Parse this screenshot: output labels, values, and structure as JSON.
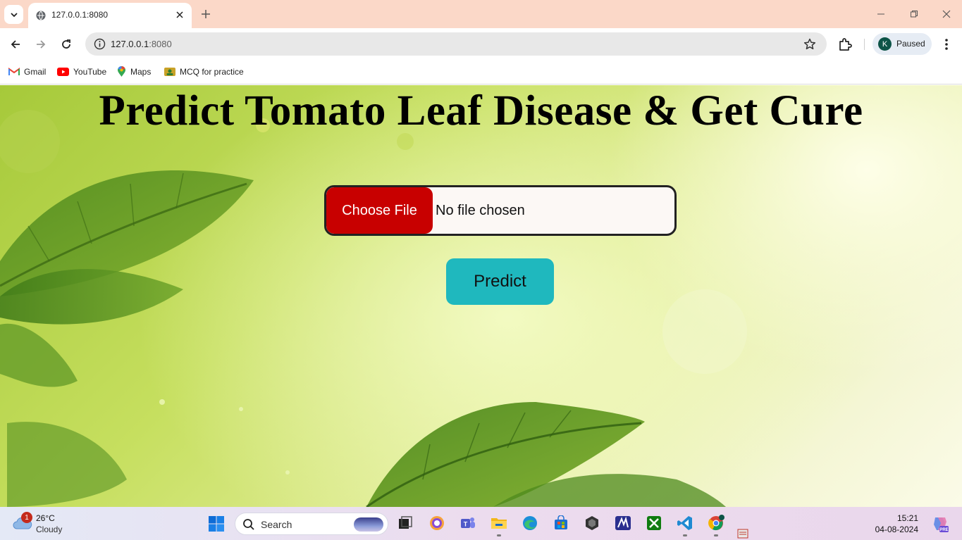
{
  "browser": {
    "tab_title": "127.0.0.1:8080",
    "url_host": "127.0.0.1",
    "url_port": ":8080",
    "profile_initial": "K",
    "profile_status": "Paused",
    "bookmarks": [
      {
        "label": "Gmail",
        "icon": "gmail-icon"
      },
      {
        "label": "YouTube",
        "icon": "youtube-icon"
      },
      {
        "label": "Maps",
        "icon": "maps-icon"
      },
      {
        "label": "MCQ for practice",
        "icon": "bookmark-folder-icon"
      }
    ]
  },
  "page": {
    "title": "Predict Tomato Leaf Disease & Get Cure",
    "file_input": {
      "button_label": "Choose File",
      "status": "No file chosen"
    },
    "predict_label": "Predict",
    "colors": {
      "choose_button": "#c80000",
      "predict_button": "#1fb8be"
    }
  },
  "taskbar": {
    "weather": {
      "temp": "26°C",
      "desc": "Cloudy",
      "badge": "1"
    },
    "search_label": "Search",
    "time": "15:21",
    "date": "04-08-2024",
    "apps": [
      "task-view",
      "copilot-app",
      "teams",
      "file-explorer",
      "edge",
      "microsoft-store",
      "unity",
      "meta-app",
      "xbox",
      "vscode",
      "chrome",
      "tray-app"
    ]
  }
}
